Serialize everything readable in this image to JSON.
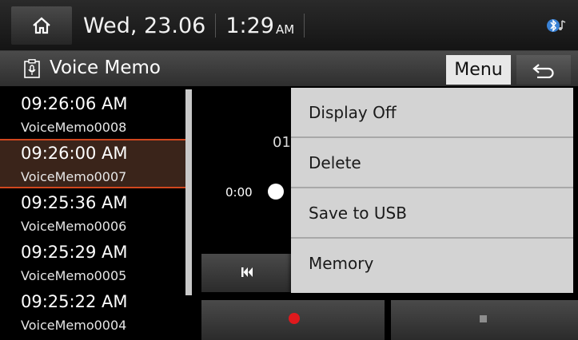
{
  "status": {
    "date": "Wed, 23.06",
    "time": "1:29",
    "ampm": "AM",
    "icons": {
      "home": "home-icon",
      "bluetooth": "bluetooth-audio-icon"
    }
  },
  "titlebar": {
    "title": "Voice Memo",
    "icon": "voice-memo-icon",
    "menu_label": "Menu",
    "back_icon": "back-arrow-icon"
  },
  "list": {
    "items": [
      {
        "time": "09:26:06 AM",
        "name": "VoiceMemo0008",
        "selected": false
      },
      {
        "time": "09:26:00 AM",
        "name": "VoiceMemo0007",
        "selected": true
      },
      {
        "time": "09:25:36 AM",
        "name": "VoiceMemo0006",
        "selected": false
      },
      {
        "time": "09:25:29 AM",
        "name": "VoiceMemo0005",
        "selected": false
      },
      {
        "time": "09:25:22 AM",
        "name": "VoiceMemo0004",
        "selected": false
      }
    ],
    "highlight_color": "#d0471e"
  },
  "player": {
    "partial_number": "01",
    "elapsed": "0:00",
    "record_color": "#e0191d",
    "icons": {
      "prev": "skip-previous-icon",
      "record": "record-icon",
      "stop": "stop-icon"
    }
  },
  "menu": {
    "items": [
      {
        "label": "Display Off"
      },
      {
        "label": "Delete"
      },
      {
        "label": "Save to USB"
      },
      {
        "label": "Memory"
      }
    ]
  }
}
